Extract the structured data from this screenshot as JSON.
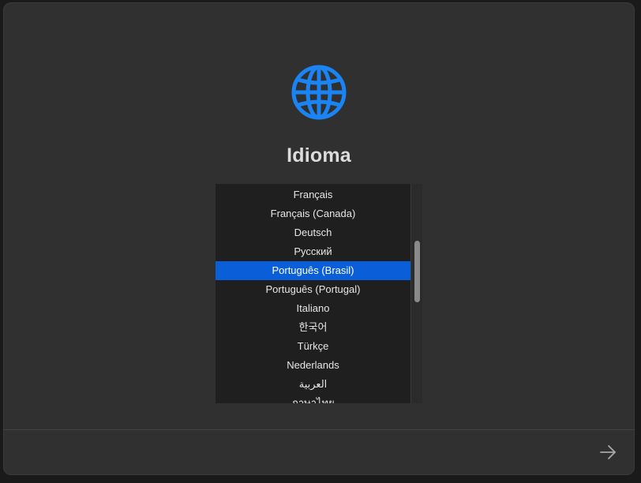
{
  "header": {
    "icon": "globe-icon",
    "icon_color": "#1a84f5",
    "title": "Idioma"
  },
  "language_list": {
    "items": [
      {
        "label": "Français"
      },
      {
        "label": "Français (Canada)"
      },
      {
        "label": "Deutsch"
      },
      {
        "label": "Русский"
      },
      {
        "label": "Português (Brasil)",
        "selected": true
      },
      {
        "label": "Português (Portugal)"
      },
      {
        "label": "Italiano"
      },
      {
        "label": "한국어"
      },
      {
        "label": "Türkçe"
      },
      {
        "label": "Nederlands"
      },
      {
        "label": "العربية"
      },
      {
        "label": "ภาษาไทย"
      }
    ],
    "selected_index": 4,
    "selection_color": "#0a5fd8"
  },
  "footer": {
    "next_icon": "arrow-right-icon"
  }
}
